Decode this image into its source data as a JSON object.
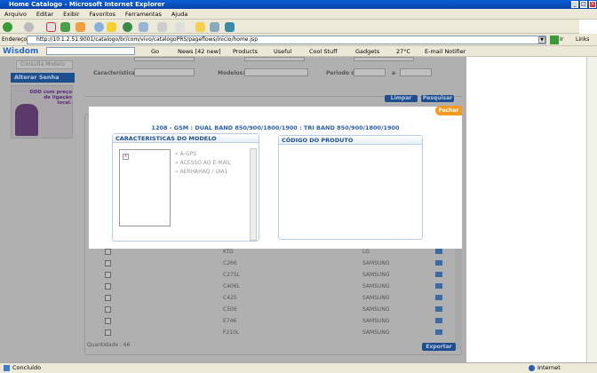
{
  "window": {
    "title": "Home Catalogo - Microsoft Internet Explorer"
  },
  "menu": [
    "Arquivo",
    "Editar",
    "Exibir",
    "Favoritos",
    "Ferramentas",
    "Ajuda"
  ],
  "address": {
    "label": "Endereço",
    "url": "http://10.1.2.51:9001/catalogo/br/com/vivo/catalogoPRS/pageflows/inicio/home.jsp",
    "go": "Ir",
    "links": "Links"
  },
  "wisdom": {
    "brand": "Wisdom",
    "go": "Go",
    "items": [
      "News [42 new]",
      "Products",
      "Useful",
      "Cool Stuff",
      "Gadgets",
      "27°C",
      "E-mail Notifier"
    ]
  },
  "sidebar": {
    "consulta": "Consulta Modelo",
    "alterar": "Alterar Senha",
    "promo": "DDD com preço de ligação local."
  },
  "filters": {
    "caracteristica": "Característica:",
    "modelos": "Modelos:",
    "periodo": "Periodo de",
    "a": "a"
  },
  "buttons": {
    "limpar": "Limpar",
    "pesquisar": "Pesquisar",
    "fechar": "Fechar",
    "exportar": "Exportar"
  },
  "modal": {
    "title": "1208 - GSM : DUAL BAND 850/900/1800/1900 : TRI BAND 850/900/1800/1900",
    "caracteristicas_header": "CARACTERISTICAS DO MODELO",
    "codigo_header": "CÓDIGO DO PRODUTO",
    "features": [
      "A-GPS",
      "ACESSO AO E-MAIL",
      "AERHAHAQ / UIA1"
    ]
  },
  "table": {
    "rows": [
      {
        "model": "KTG",
        "maker": "LG"
      },
      {
        "model": "C266",
        "maker": "SAMSUNG"
      },
      {
        "model": "C275L",
        "maker": "SAMSUNG"
      },
      {
        "model": "C406L",
        "maker": "SAMSUNG"
      },
      {
        "model": "C425",
        "maker": "SAMSUNG"
      },
      {
        "model": "C506",
        "maker": "SAMSUNG"
      },
      {
        "model": "E746",
        "maker": "SAMSUNG"
      },
      {
        "model": "F210L",
        "maker": "SAMSUNG"
      }
    ],
    "quantidade": "Quantidade : 66"
  },
  "status": {
    "text": "Concluído",
    "zone": "Internet"
  }
}
